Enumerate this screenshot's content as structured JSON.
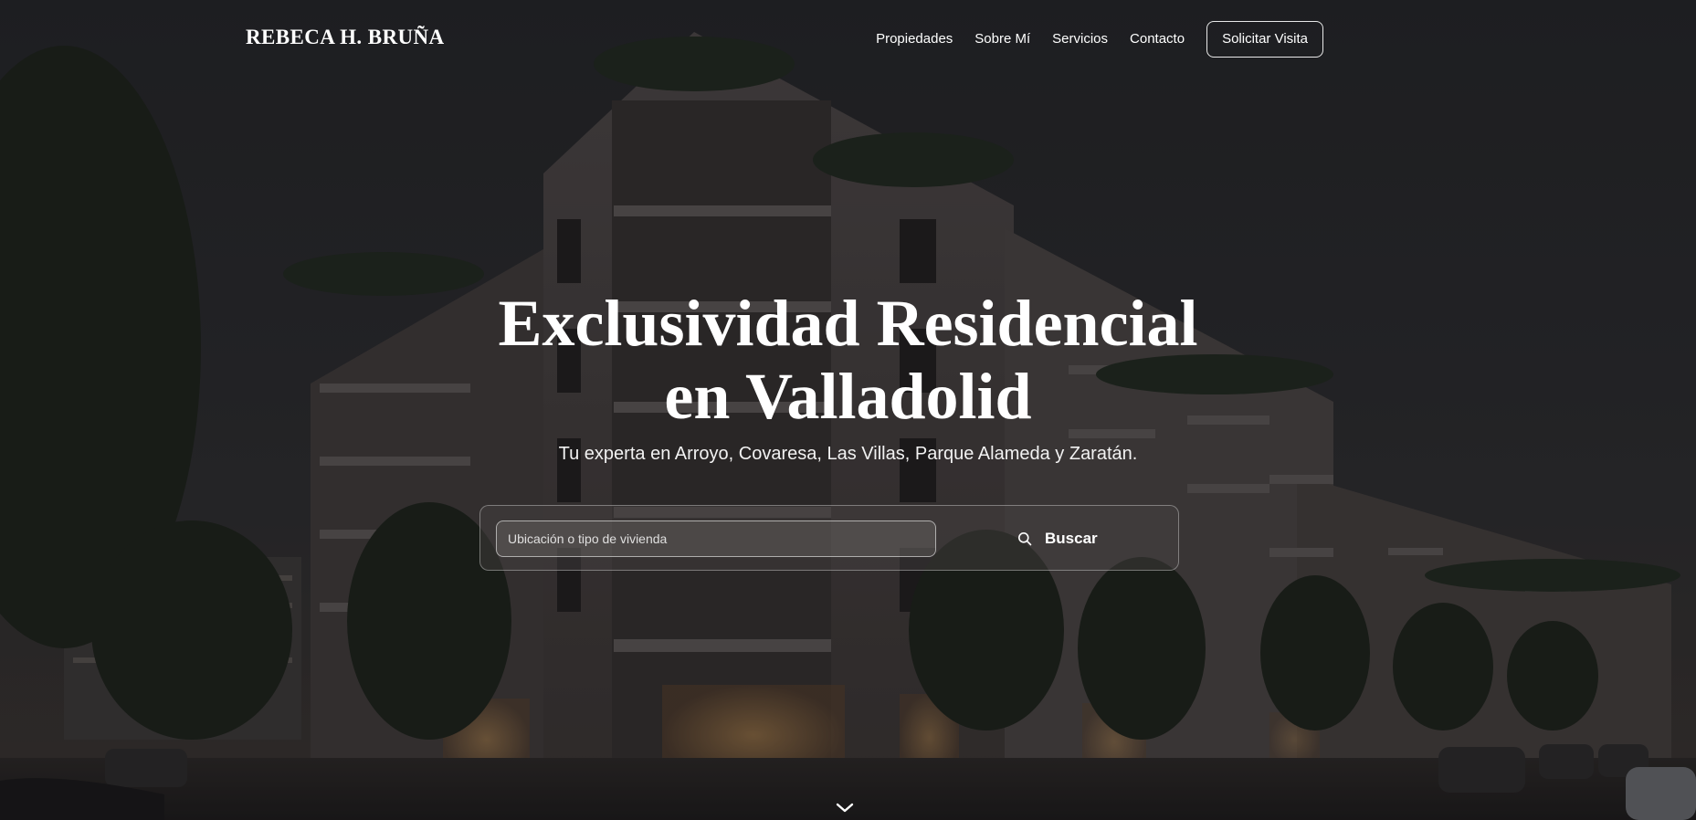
{
  "brand": "REBECA H. BRUÑA",
  "nav": {
    "links": [
      "Propiedades",
      "Sobre Mí",
      "Servicios",
      "Contacto"
    ],
    "cta_label": "Solicitar Visita"
  },
  "hero": {
    "title_line1": "Exclusividad Residencial",
    "title_line2": "en Valladolid",
    "subtitle": "Tu experta en Arroyo, Covaresa, Las Villas, Parque Alameda y Zaratán."
  },
  "search": {
    "placeholder": "Ubicación o tipo de vivienda",
    "value": "",
    "button_label": "Buscar",
    "button_icon": "search-icon"
  },
  "scroll_icon": "chevron-down-icon",
  "colors": {
    "text": "#ffffff",
    "overlay": "#141416",
    "sky": "#26272a"
  }
}
